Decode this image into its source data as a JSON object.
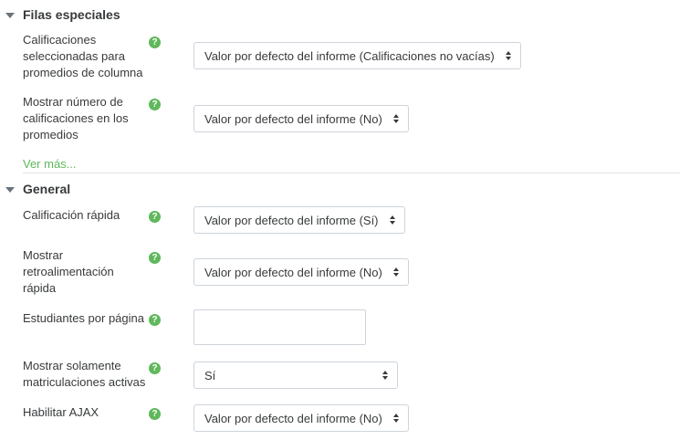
{
  "sections": {
    "filas": {
      "title": "Filas especiales"
    },
    "general": {
      "title": "General"
    }
  },
  "help_glyph": "?",
  "filas_rows": {
    "calificaciones": {
      "label": "Calificaciones seleccionadas para promedios de columna",
      "value": "Valor por defecto del informe (Calificaciones no vacías)"
    },
    "numero": {
      "label": "Mostrar número de calificaciones en los promedios",
      "value": "Valor por defecto del informe (No)"
    }
  },
  "ver_mas": "Ver más...",
  "general_rows": {
    "rapida": {
      "label": "Calificación rápida",
      "value": "Valor por defecto del informe (Sí)"
    },
    "retro": {
      "label": "Mostrar retroalimentación rápida",
      "value": "Valor por defecto del informe (No)"
    },
    "estudiantes": {
      "label": "Estudiantes por página",
      "value": ""
    },
    "activas": {
      "label": "Mostrar solamente matriculaciones activas",
      "value": "Sí"
    },
    "ajax": {
      "label": "Habilitar AJAX",
      "value": "Valor por defecto del informe (No)"
    }
  },
  "colors": {
    "accent": "#5fb85b",
    "text": "#373a3c",
    "border": "#ced4da"
  }
}
